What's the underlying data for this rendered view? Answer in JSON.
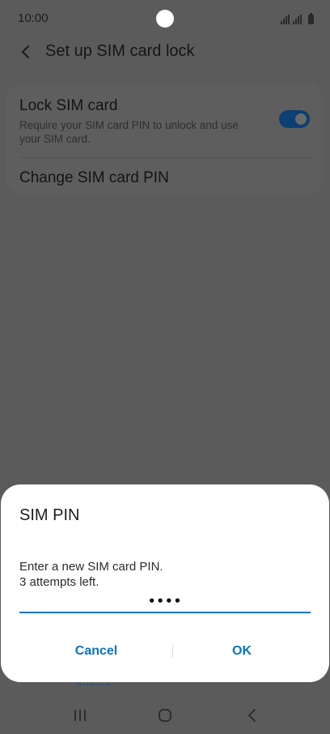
{
  "status_bar": {
    "time": "10:00"
  },
  "app_bar": {
    "title": "Set up SIM card lock",
    "back_icon": "arrow-back-icon"
  },
  "settings": {
    "lock_sim": {
      "title": "Lock SIM card",
      "description": "Require your SIM card PIN to unlock and use your SIM card.",
      "toggle_on": true
    },
    "change_pin": {
      "label": "Change SIM card PIN"
    }
  },
  "dialog": {
    "title": "SIM PIN",
    "message": "Enter a new SIM card PIN.\n3 attempts left.",
    "pin_value": "••••",
    "cancel_label": "Cancel",
    "ok_label": "OK"
  },
  "colors": {
    "accent": "#0a74c2",
    "scrim_background": "#5b5b5b",
    "dialog_background": "#ffffff"
  },
  "nav": {
    "recents_icon": "recents-icon",
    "home_icon": "home-icon",
    "back_icon": "back-icon"
  }
}
